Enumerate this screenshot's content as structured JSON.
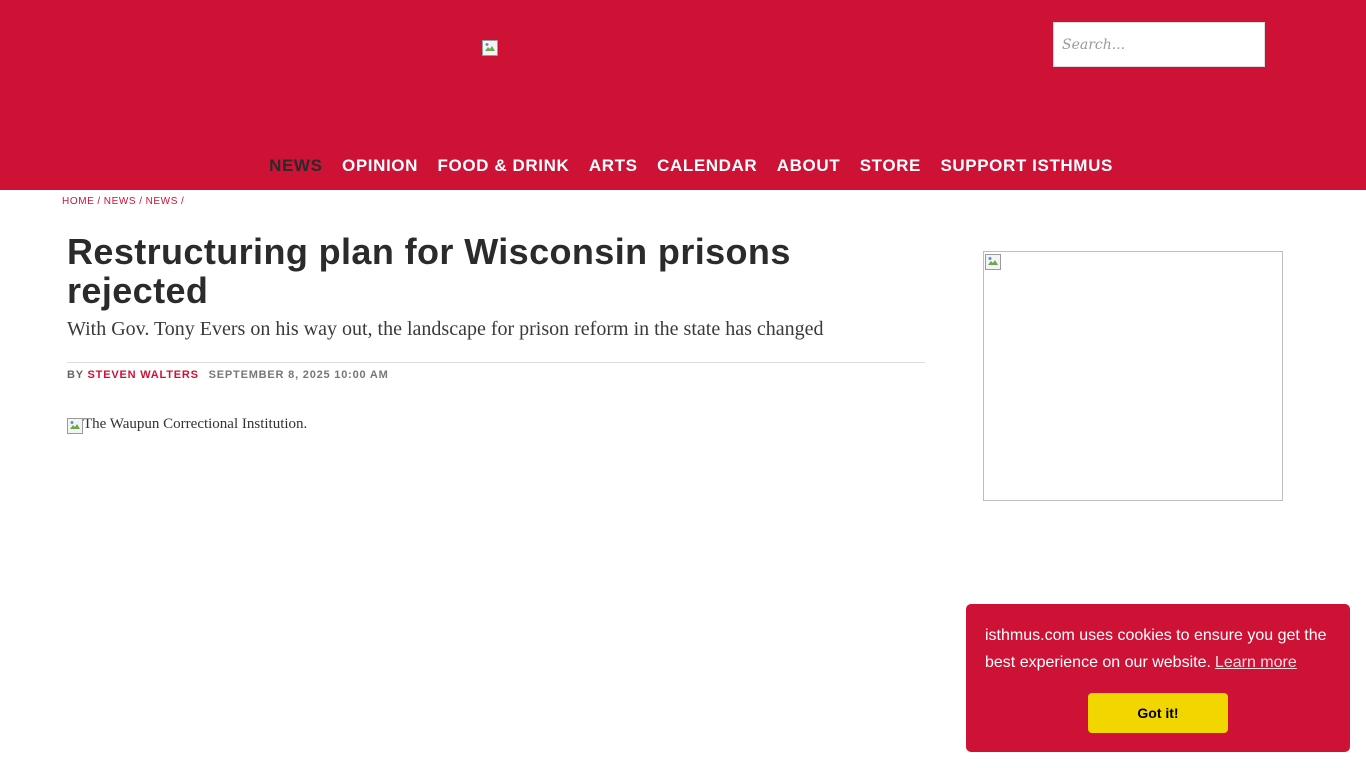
{
  "header": {
    "search_placeholder": "Search...",
    "brand_color": "#cd1236"
  },
  "nav": {
    "items": [
      {
        "label": "NEWS",
        "active": true
      },
      {
        "label": "OPINION"
      },
      {
        "label": "FOOD & DRINK"
      },
      {
        "label": "ARTS"
      },
      {
        "label": "CALENDAR"
      },
      {
        "label": "ABOUT"
      },
      {
        "label": "STORE"
      },
      {
        "label": "SUPPORT ISTHMUS"
      }
    ]
  },
  "breadcrumb": {
    "items": [
      "HOME",
      "NEWS",
      "NEWS"
    ],
    "separator": "/"
  },
  "article": {
    "title": "Restructuring plan for Wisconsin prisons rejected",
    "dek": "With Gov. Tony Evers on his way out, the landscape for prison reform in the state has changed",
    "by": "BY",
    "author": "STEVEN WALTERS",
    "date": "SEPTEMBER 8, 2025 10:00 AM",
    "image_alt": "The Waupun Correctional Institution."
  },
  "cookie": {
    "message": "isthmus.com uses cookies to ensure you get the best experience on our website.",
    "learn_more": "Learn more",
    "button": "Got it!",
    "button_color": "#f1d600"
  }
}
